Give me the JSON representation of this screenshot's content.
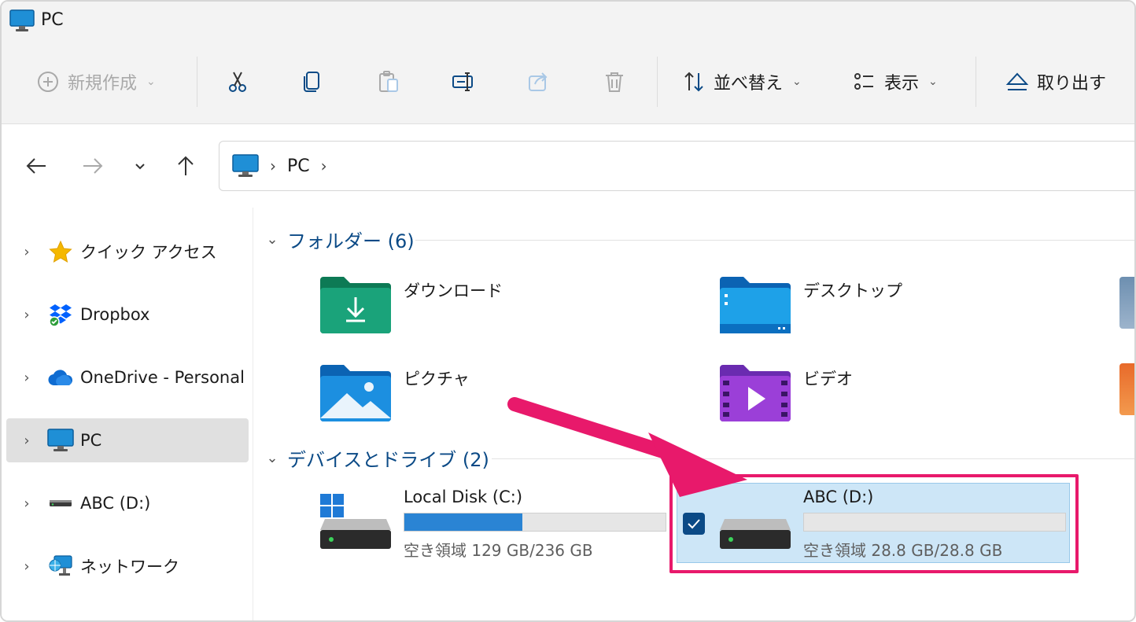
{
  "window": {
    "title": "PC"
  },
  "toolbar": {
    "new_label": "新規作成",
    "sort_label": "並べ替え",
    "view_label": "表示",
    "eject_label": "取り出す"
  },
  "address": {
    "crumb": "PC"
  },
  "sidebar": {
    "items": [
      {
        "label": "クイック アクセス",
        "icon": "star-icon"
      },
      {
        "label": "Dropbox",
        "icon": "dropbox-icon"
      },
      {
        "label": "OneDrive - Personal",
        "icon": "cloud-icon"
      },
      {
        "label": "PC",
        "icon": "monitor-icon",
        "selected": true
      },
      {
        "label": "ABC (D:)",
        "icon": "drive-icon"
      },
      {
        "label": "ネットワーク",
        "icon": "network-icon"
      }
    ]
  },
  "folders": {
    "header": "フォルダー (6)",
    "items": [
      {
        "label": "ダウンロード",
        "icon": "downloads-folder-icon"
      },
      {
        "label": "デスクトップ",
        "icon": "desktop-folder-icon"
      },
      {
        "label": "ピクチャ",
        "icon": "pictures-folder-icon"
      },
      {
        "label": "ビデオ",
        "icon": "videos-folder-icon"
      }
    ]
  },
  "drives": {
    "header": "デバイスとドライブ (2)",
    "items": [
      {
        "name": "Local Disk (C:)",
        "free_text": "空き領域 129 GB/236 GB",
        "used_fraction": 0.453
      },
      {
        "name": "ABC (D:)",
        "free_text": "空き領域 28.8 GB/28.8 GB",
        "used_fraction": 0.0,
        "selected": true
      }
    ]
  },
  "colors": {
    "accent": "#0b4a86",
    "highlight": "#e8196b",
    "selection": "#cde6f7",
    "bar_fill": "#2a84d4"
  }
}
